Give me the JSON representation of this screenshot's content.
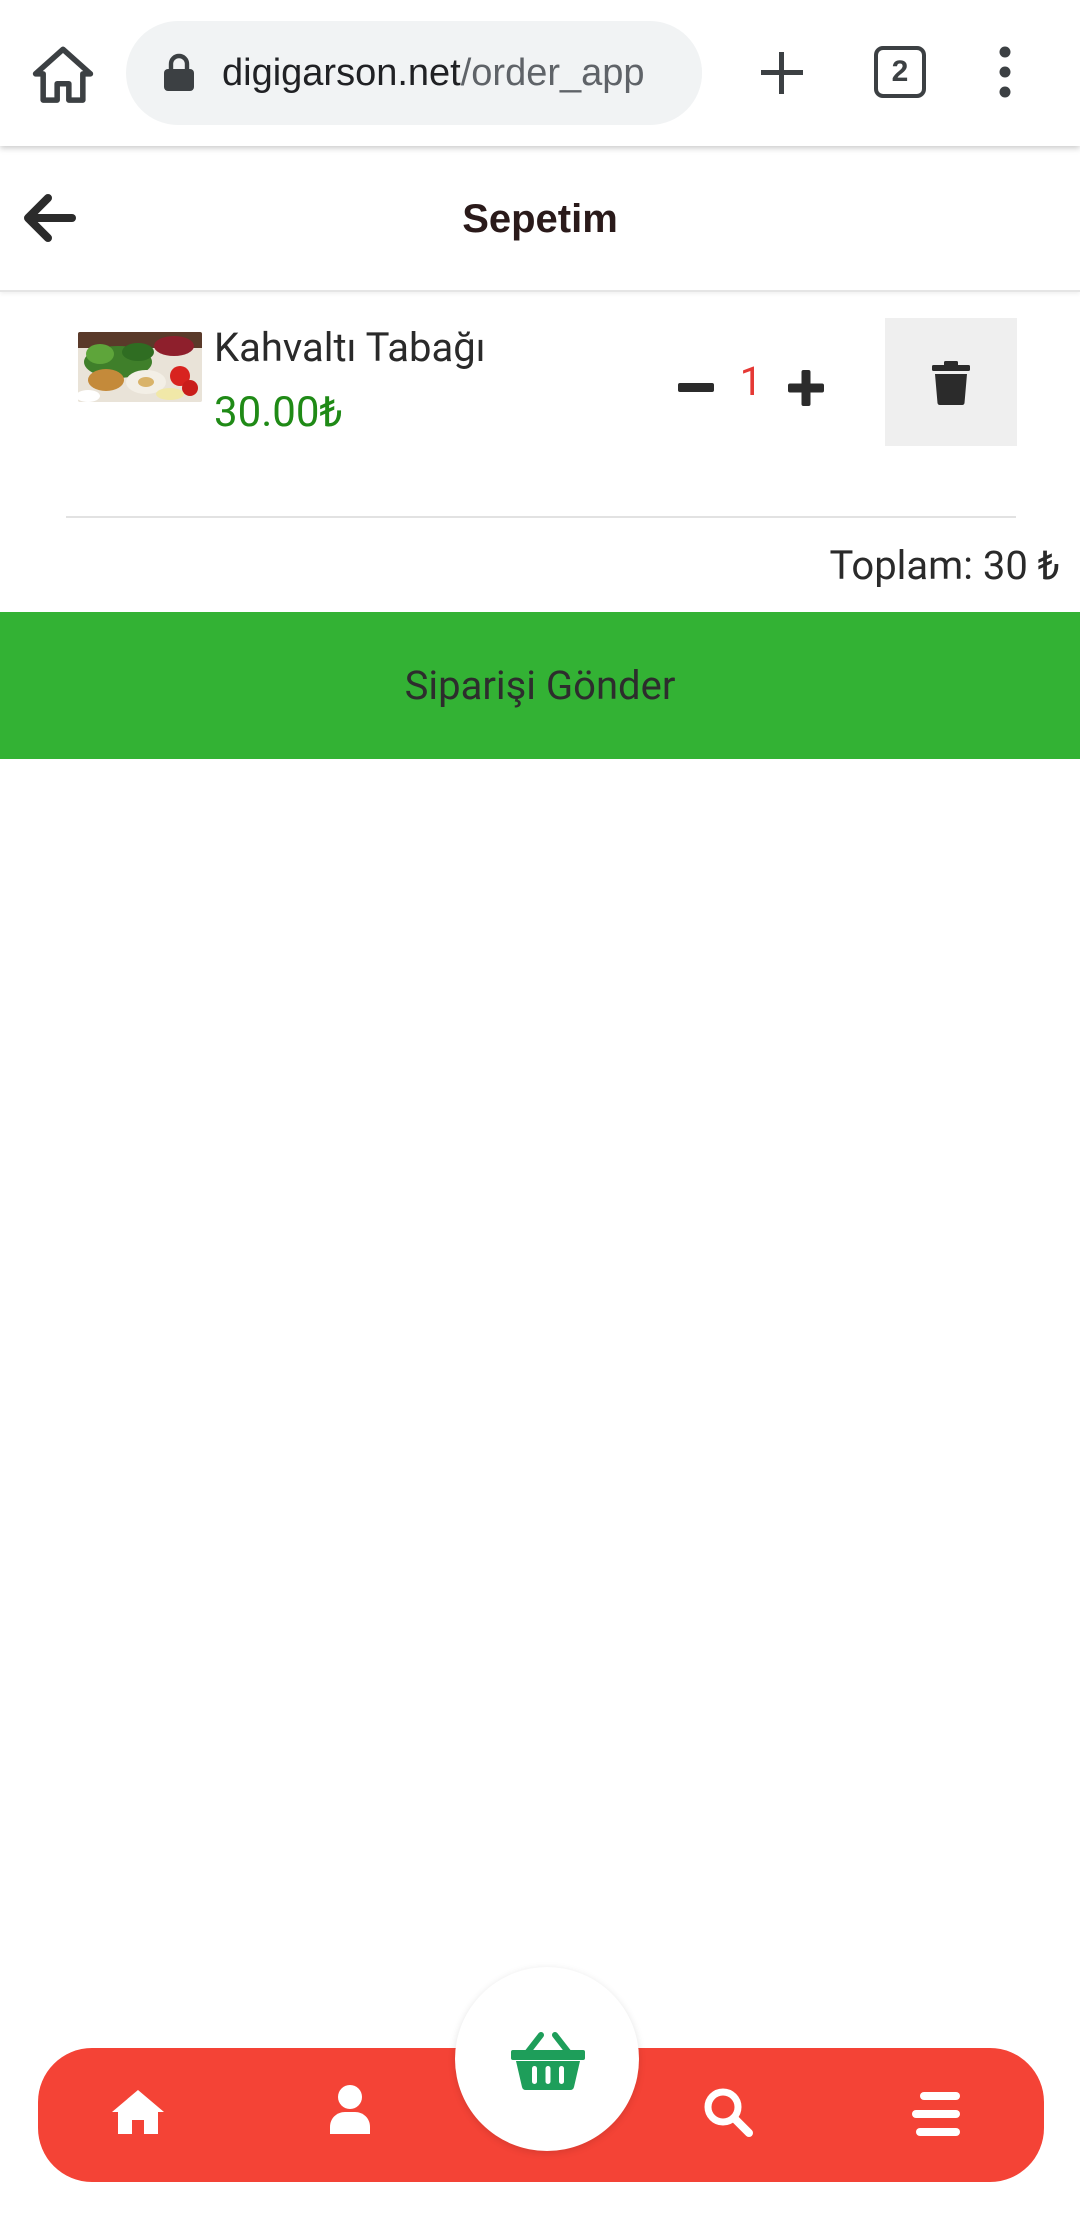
{
  "browser": {
    "url_domain": "digigarson.net",
    "url_path": "/order_app",
    "tab_count": "2"
  },
  "header": {
    "title": "Sepetim"
  },
  "cart": {
    "items": [
      {
        "name": "Kahvaltı Tabağı",
        "price": "30.00₺",
        "quantity": "1",
        "image": "breakfast-plate-photo"
      }
    ],
    "total_label": "Toplam: 30 ₺"
  },
  "actions": {
    "submit_label": "Siparişi Gönder"
  },
  "bottom_nav": {
    "items": [
      "home-icon",
      "user-icon",
      "basket-icon",
      "search-icon",
      "menu-icon"
    ]
  },
  "colors": {
    "submit_green": "#33b234",
    "price_green": "#1f8a16",
    "quantity_red": "#e53935",
    "nav_red": "#f44336",
    "basket_green": "#1e9e5a"
  }
}
